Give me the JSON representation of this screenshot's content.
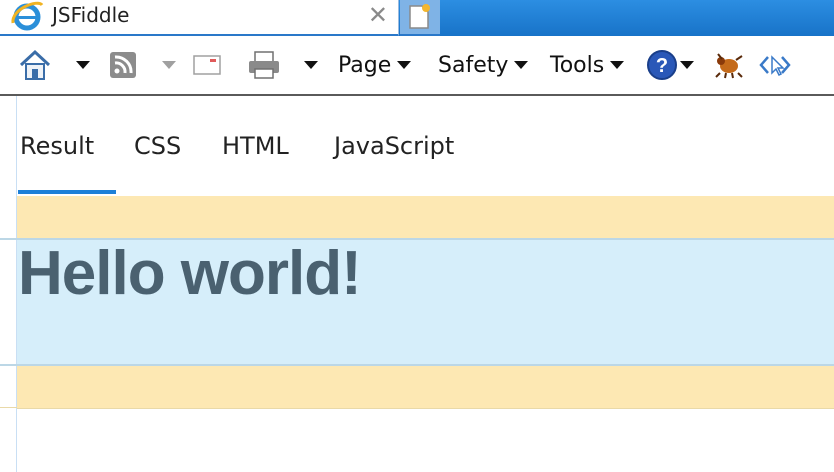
{
  "browser": {
    "tab_title": "JSFiddle",
    "close_symbol": "✕",
    "accent": "#1e7fd6"
  },
  "commandbar": {
    "page_label": "Page",
    "safety_label": "Safety",
    "tools_label": "Tools",
    "icons": [
      "home-icon",
      "feeds-icon",
      "read-mail-icon",
      "print-icon",
      "help-icon",
      "bug-icon",
      "developer-tools-icon"
    ]
  },
  "content_tabs": [
    {
      "label": "Result",
      "selected": true
    },
    {
      "label": "CSS"
    },
    {
      "label": "HTML"
    },
    {
      "label": "JavaScript"
    }
  ],
  "result": {
    "heading": "Hello world!",
    "colors": {
      "margin": "#fde8b3",
      "content": "#d6eefa",
      "heading": "#4a6170"
    }
  }
}
